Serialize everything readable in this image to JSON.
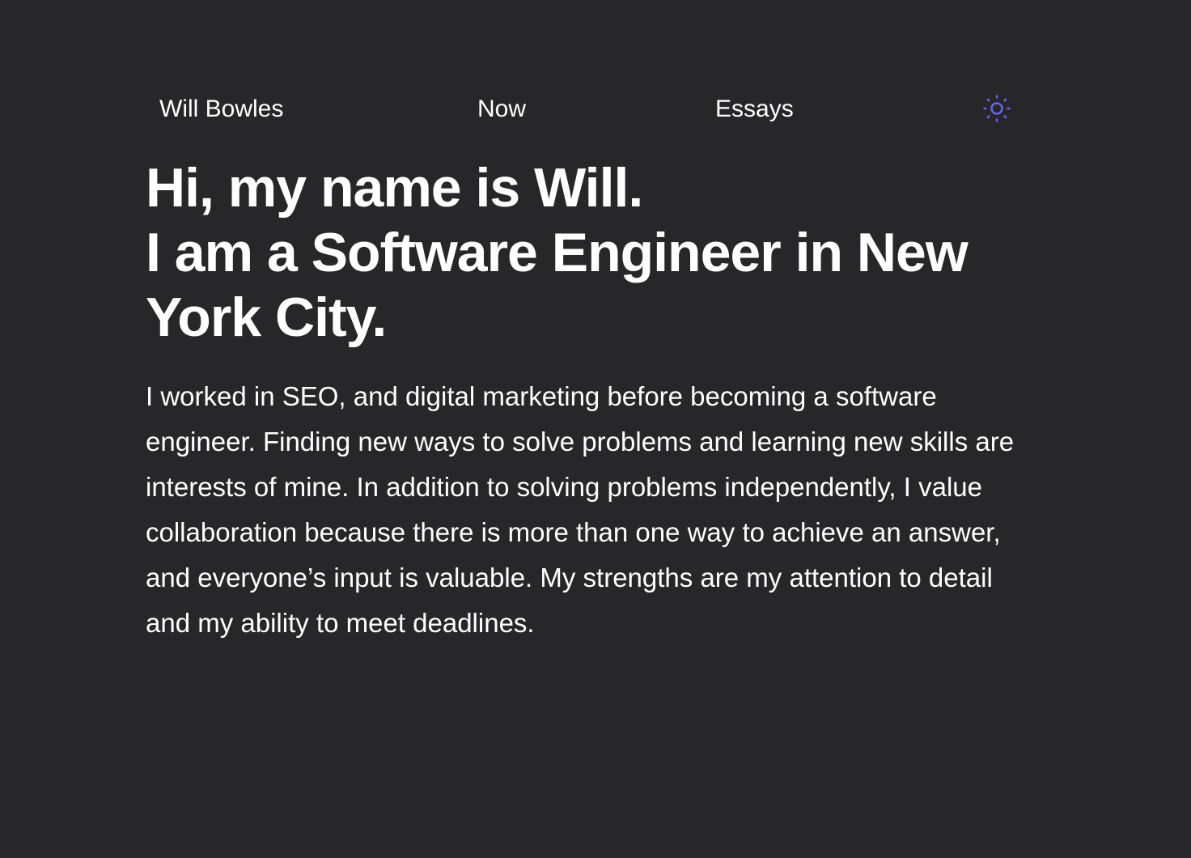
{
  "nav": {
    "home_label": "Will Bowles",
    "now_label": "Now",
    "essays_label": "Essays",
    "theme_icon": "sun-icon",
    "accent_color": "#6366f1"
  },
  "hero": {
    "line1": "Hi, my name is Will.",
    "line2": "I am a Software Engineer in New York City."
  },
  "bio": {
    "text": "I worked in SEO, and digital marketing before becoming a software engineer. Finding new ways to solve problems and learning new skills are interests of mine. In addition to solving problems independently, I value collaboration because there is more than one way to achieve an answer, and everyone’s input is valuable. My strengths are my attention to detail and my ability to meet deadlines."
  }
}
